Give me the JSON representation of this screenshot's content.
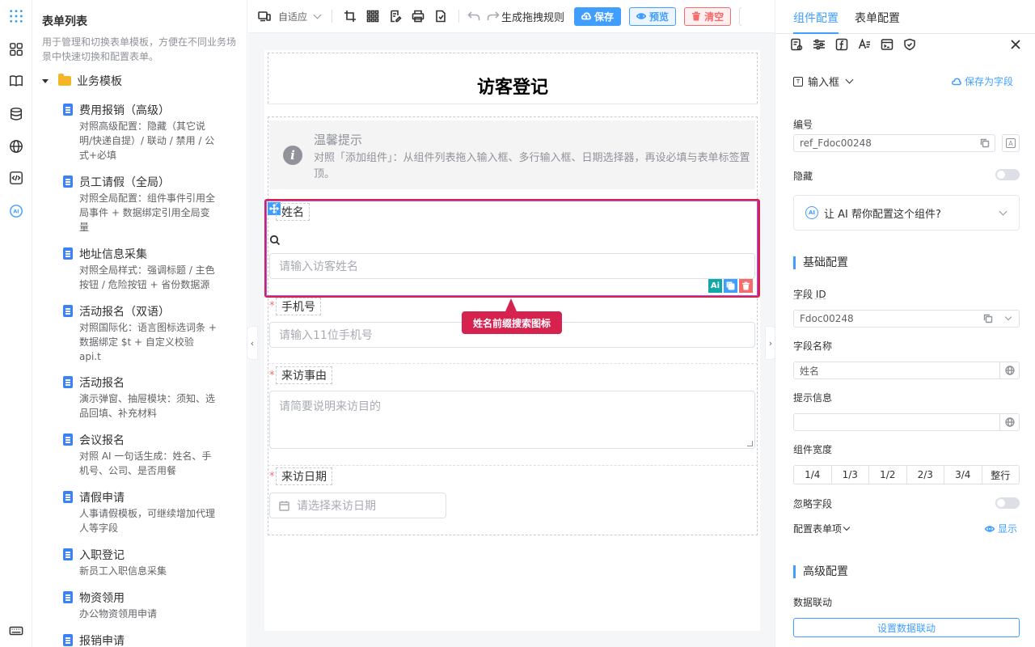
{
  "form_list": {
    "title": "表单列表",
    "description": "用于管理和切换表单模板，方便在不同业务场景中快速切换和配置表单。",
    "group": "业务模板",
    "items": [
      {
        "title": "费用报销（高级）",
        "desc": "对照高级配置：隐藏（其它说明/快递自提）/ 联动 / 禁用 / 公式+必填"
      },
      {
        "title": "员工请假（全局）",
        "desc": "对照全局配置：组件事件引用全局事件 + 数据绑定引用全局变量"
      },
      {
        "title": "地址信息采集",
        "desc": "对照全局样式：强调标题 / 主色按钮 / 危险按钮 + 省份数据源"
      },
      {
        "title": "活动报名（双语）",
        "desc": "对照国际化：语言图标选词条 + 数据绑定 $t + 自定义校验 api.t"
      },
      {
        "title": "活动报名",
        "desc": "演示弹窗、抽屉模块：须知、选品回填、补充材料"
      },
      {
        "title": "会议报名",
        "desc": "对照 AI 一句话生成：姓名、手机号、公司、是否用餐"
      },
      {
        "title": "请假申请",
        "desc": "人事请假模板，可继续增加代理人等字段"
      },
      {
        "title": "入职登记",
        "desc": "新员工入职信息采集"
      },
      {
        "title": "物资领用",
        "desc": "办公物资领用申请"
      },
      {
        "title": "报销申请",
        "desc": ""
      }
    ]
  },
  "toolbar": {
    "adapt_label": "自适应",
    "drag_rule_label": "生成拖拽规则",
    "save_label": "保存",
    "preview_label": "预览",
    "clear_label": "清空"
  },
  "canvas": {
    "form_title": "访客登记",
    "tip": {
      "title": "温馨提示",
      "icon_glyph": "i",
      "text": "对照「添加组件」：从组件列表拖入输入框、多行输入框、日期选择器，再设必填与表单标签置顶。"
    },
    "fields": [
      {
        "label": "姓名",
        "placeholder": "请输入访客姓名",
        "required": ""
      },
      {
        "label": "手机号",
        "placeholder": "请输入11位手机号",
        "required": "*"
      },
      {
        "label": "来访事由",
        "placeholder": "请简要说明来访目的",
        "required": "*"
      },
      {
        "label": "来访日期",
        "placeholder": "请选择来访日期",
        "required": "*"
      }
    ],
    "mini_ai_label": "Ai",
    "callout": "姓名前缀搜索图标"
  },
  "config_panel": {
    "tabs": [
      "组件配置",
      "表单配置"
    ],
    "component_type": "输入框",
    "save_as_field": "保存为字段",
    "id_label": "编号",
    "id_value": "ref_Fdoc00248",
    "hidden_label": "隐藏",
    "ai_prompt": "让 AI 帮你配置这个组件?",
    "ai_badge": "AI",
    "basic_title": "基础配置",
    "field_id_label": "字段 ID",
    "field_id_value": "Fdoc00248",
    "field_name_label": "字段名称",
    "field_name_value": "姓名",
    "hint_label": "提示信息",
    "hint_value": "",
    "width_label": "组件宽度",
    "width_options": [
      "1/4",
      "1/3",
      "1/2",
      "2/3",
      "3/4",
      "整行"
    ],
    "ignore_label": "忽略字段",
    "form_items_label": "配置表单项",
    "show_label": "显示",
    "advanced_title": "高级配置",
    "linkage_label": "数据联动",
    "linkage_button": "设置数据联动"
  },
  "colors": {
    "primary": "#409eff",
    "danger": "#f56c6c",
    "highlight": "#d6224f"
  }
}
